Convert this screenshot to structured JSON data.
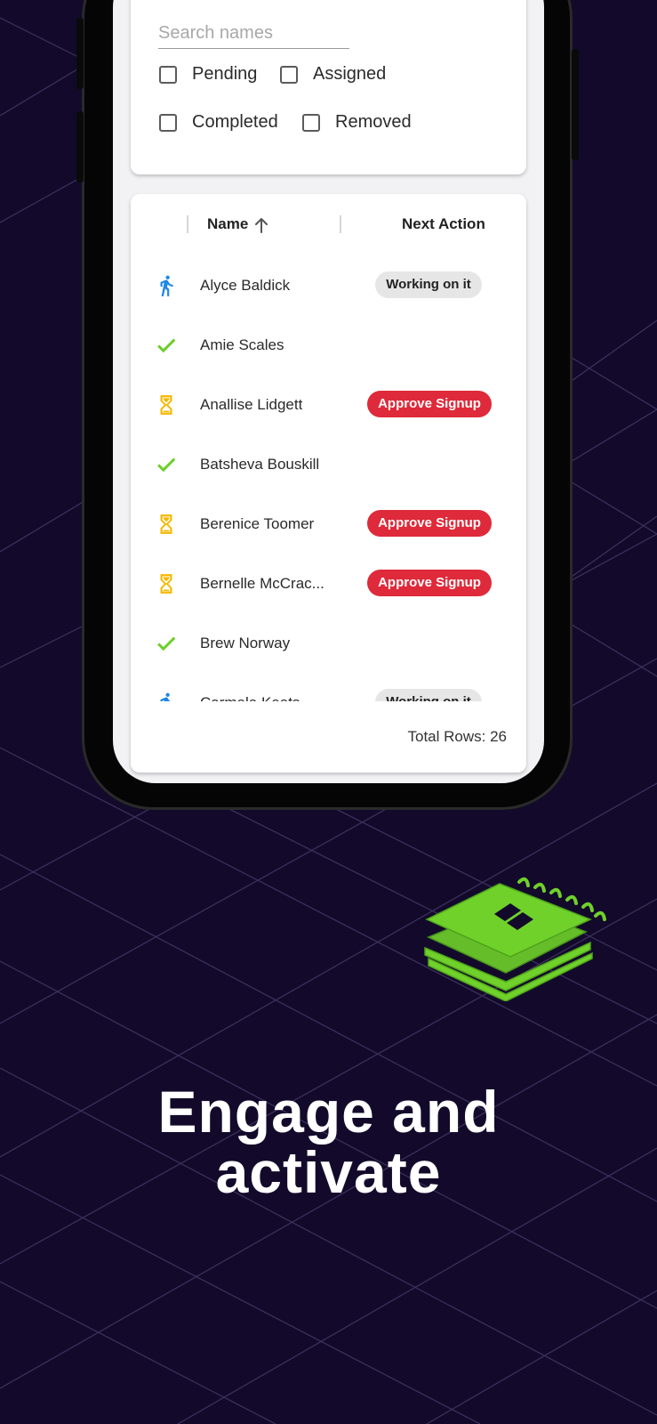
{
  "filters": {
    "search_placeholder": "Search names",
    "checkboxes": [
      {
        "label": "Pending",
        "checked": false
      },
      {
        "label": "Assigned",
        "checked": false
      },
      {
        "label": "Completed",
        "checked": false
      },
      {
        "label": "Removed",
        "checked": false
      }
    ]
  },
  "table": {
    "columns": {
      "name": "Name",
      "next_action": "Next Action"
    },
    "sort": {
      "column": "Name",
      "direction": "ascending"
    },
    "rows": [
      {
        "status": "running-icon",
        "name": "Alyce Baldick",
        "action": "Working on it",
        "action_style": "working"
      },
      {
        "status": "check-icon",
        "name": "Amie Scales",
        "action": "",
        "action_style": ""
      },
      {
        "status": "hourglass-icon",
        "name": "Anallise Lidgett",
        "action": "Approve Signup",
        "action_style": "approve"
      },
      {
        "status": "check-icon",
        "name": "Batsheva Bouskill",
        "action": "",
        "action_style": ""
      },
      {
        "status": "hourglass-icon",
        "name": "Berenice Toomer",
        "action": "Approve Signup",
        "action_style": "approve"
      },
      {
        "status": "hourglass-icon",
        "name": "Bernelle McCrac...",
        "action": "Approve Signup",
        "action_style": "approve"
      },
      {
        "status": "check-icon",
        "name": "Brew Norway",
        "action": "",
        "action_style": ""
      },
      {
        "status": "running-icon",
        "name": "Carmela Keats",
        "action": "Working on it",
        "action_style": "working"
      }
    ],
    "total_rows": "Total Rows: 26"
  },
  "headline": {
    "line1": "Engage and",
    "line2": "activate"
  },
  "colors": {
    "background": "#130a2b",
    "approve_chip": "#de2a3a",
    "working_chip": "#e6e6e6",
    "check": "#6ccf2c",
    "hourglass": "#f5b800",
    "running": "#1e88e5",
    "notebook": "#6fd12a"
  }
}
